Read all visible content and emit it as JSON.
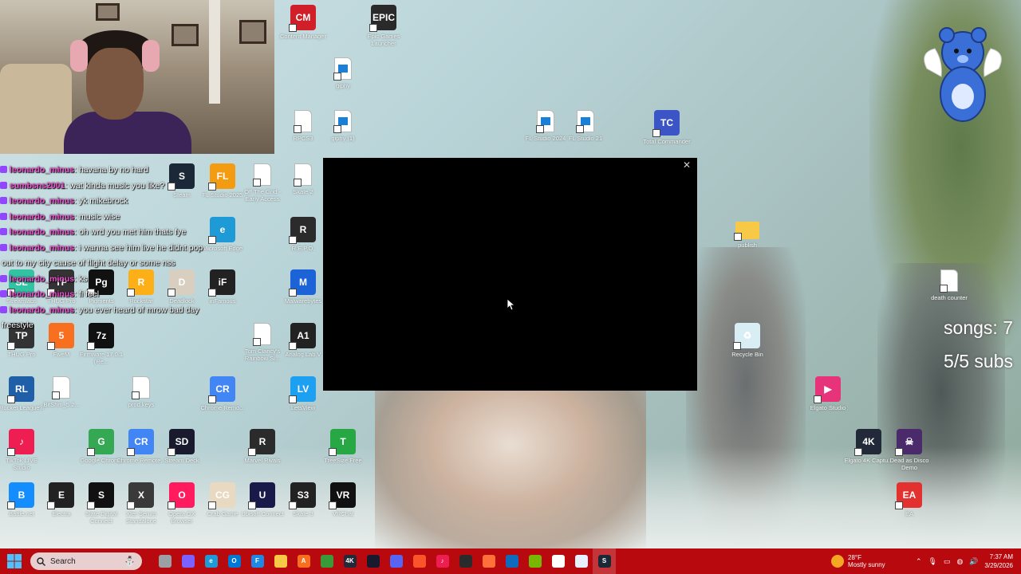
{
  "webcam": {
    "label": "webcam"
  },
  "chat": [
    {
      "user": "leonardo_minus",
      "text": ": havana by no hard"
    },
    {
      "user": "sumbsns2001",
      "text": ": wat kinda music you like?"
    },
    {
      "user": "leonardo_minus",
      "text": ": yk mikebrock"
    },
    {
      "user": "leonardo_minus",
      "text": ": music wise"
    },
    {
      "user": "leonardo_minus",
      "text": ": oh wrd you met him thats fye"
    },
    {
      "user": "leonardo_minus",
      "text": ": i wanna see him live he didnt pop"
    },
    {
      "user": "",
      "text": "out to my city cause of flight delay or some nss"
    },
    {
      "user": "leonardo_minus",
      "text": ": ks"
    },
    {
      "user": "leonardo_minus",
      "text": ": fi feel"
    },
    {
      "user": "leonardo_minus",
      "text": ": you ever heard of mrow bad day"
    },
    {
      "user": "",
      "text": "freestyle"
    }
  ],
  "desktop_icons": [
    {
      "label": "Content Manager",
      "icon": "content-manager-icon",
      "color": "#d11f2a",
      "glyph": "CM"
    },
    {
      "label": "Epic Games Launcher",
      "icon": "epic-games-icon",
      "color": "#2a2a2a",
      "glyph": "EPIC"
    },
    {
      "label": "giphy",
      "icon": "image-file-icon",
      "color": "#ffffff",
      "glyph": ""
    },
    {
      "label": "RPCS3",
      "icon": "file-icon",
      "color": "#ffffff",
      "glyph": ""
    },
    {
      "label": "giphy (1)",
      "icon": "image-file-icon",
      "color": "#ffffff",
      "glyph": ""
    },
    {
      "label": "FL Studio 2024",
      "icon": "image-file-icon",
      "color": "#ffffff",
      "glyph": ""
    },
    {
      "label": "FL Studio 21",
      "icon": "image-file-icon",
      "color": "#ffffff",
      "glyph": ""
    },
    {
      "label": "Total Commander",
      "icon": "floppy-icon",
      "color": "#3b55c6",
      "glyph": "TC"
    },
    {
      "label": "Steam",
      "icon": "steam-icon",
      "color": "#1b2838",
      "glyph": "S"
    },
    {
      "label": "FL Studio 2025",
      "icon": "fl-studio-icon",
      "color": "#f39c12",
      "glyph": "FL"
    },
    {
      "label": "Off The Grid - Early Access",
      "icon": "file-icon",
      "color": "#ffffff",
      "glyph": ""
    },
    {
      "label": "Skate 2",
      "icon": "file-icon",
      "color": "#ffffff",
      "glyph": ""
    },
    {
      "label": "Microsoft Edge",
      "icon": "edge-icon",
      "color": "#1e9bd7",
      "glyph": "e"
    },
    {
      "label": "R.E.P.O.",
      "icon": "repo-icon",
      "color": "#2b2b2b",
      "glyph": "R"
    },
    {
      "label": "publish",
      "icon": "folder-icon",
      "color": "#f8c947",
      "glyph": ""
    },
    {
      "label": "death counter",
      "icon": "file-icon",
      "color": "#ffffff",
      "glyph": ""
    },
    {
      "label": "Streamlabs",
      "icon": "streamlabs-icon",
      "color": "#31c3a2",
      "glyph": "SL"
    },
    {
      "label": "THUG Pro",
      "icon": "thug-pro-icon",
      "color": "#333333",
      "glyph": "TP"
    },
    {
      "label": "Pigments",
      "icon": "pigments-icon",
      "color": "#111111",
      "glyph": "Pg"
    },
    {
      "label": "Rockstar",
      "icon": "rockstar-icon",
      "color": "#fcaf17",
      "glyph": "R"
    },
    {
      "label": "Deadlock",
      "icon": "deadlock-icon",
      "color": "#d8cfc0",
      "glyph": "D"
    },
    {
      "label": "inFamous",
      "icon": "infamous-icon",
      "color": "#222222",
      "glyph": "iF"
    },
    {
      "label": "Malwarebytes",
      "icon": "malwarebytes-icon",
      "color": "#1c63d8",
      "glyph": "M"
    },
    {
      "label": "THUG Pro",
      "icon": "thug-pro-icon",
      "color": "#333333",
      "glyph": "TP"
    },
    {
      "label": "FiveM",
      "icon": "fivem-icon",
      "color": "#f76f1f",
      "glyph": "5"
    },
    {
      "label": "Firmware 17.0.1 (Re...",
      "icon": "7zip-icon",
      "color": "#111111",
      "glyph": "7z"
    },
    {
      "label": "Tom Clancy's Rainbow Si...",
      "icon": "file-icon",
      "color": "#ffffff",
      "glyph": ""
    },
    {
      "label": "Analog Lab V",
      "icon": "analog-lab-icon",
      "color": "#222222",
      "glyph": "A1"
    },
    {
      "label": "Recycle Bin",
      "icon": "recycle-bin-icon",
      "color": "#d9edf5",
      "glyph": "♻"
    },
    {
      "label": "Rocket League®",
      "icon": "rocket-league-icon",
      "color": "#1f5fa8",
      "glyph": "RL"
    },
    {
      "label": "BitShm_5.2...",
      "icon": "file-icon",
      "color": "#ffffff",
      "glyph": ""
    },
    {
      "label": "prod.keys",
      "icon": "file-icon",
      "color": "#ffffff",
      "glyph": ""
    },
    {
      "label": "Chrome Remo...",
      "icon": "chrome-remote-icon",
      "color": "#4285f4",
      "glyph": "CR"
    },
    {
      "label": "LetsView",
      "icon": "letsview-icon",
      "color": "#1da0f2",
      "glyph": "LV"
    },
    {
      "label": "Elgato Studio",
      "icon": "elgato-studio-icon",
      "color": "#e6337a",
      "glyph": "▶"
    },
    {
      "label": "TikTok LIVE Studio",
      "icon": "tiktok-icon",
      "color": "#ee1d52",
      "glyph": "♪"
    },
    {
      "label": "Google Chrome",
      "icon": "chrome-icon",
      "color": "#34a853",
      "glyph": "G"
    },
    {
      "label": "Chrome Remote...",
      "icon": "chrome-remote-icon",
      "color": "#4285f4",
      "glyph": "CR"
    },
    {
      "label": "Stream Deck",
      "icon": "stream-deck-icon",
      "color": "#1a1a2e",
      "glyph": "SD"
    },
    {
      "label": "Marvel Rivals",
      "icon": "marvel-rivals-icon",
      "color": "#2b2b2b",
      "glyph": "R"
    },
    {
      "label": "TreeSize Free",
      "icon": "treesize-icon",
      "color": "#28a745",
      "glyph": "T"
    },
    {
      "label": "Elgato 4K Captu...",
      "icon": "elgato-4k-icon",
      "color": "#222a3a",
      "glyph": "4K"
    },
    {
      "label": "Dead as Disco Demo",
      "icon": "dead-as-disco-icon",
      "color": "#4b2a6b",
      "glyph": "☠"
    },
    {
      "label": "Battle.net",
      "icon": "battlenet-icon",
      "color": "#148eff",
      "glyph": "B"
    },
    {
      "label": "Electra",
      "icon": "electra-icon",
      "color": "#222222",
      "glyph": "E"
    },
    {
      "label": "Slate Digital Connect",
      "icon": "slate-digital-icon",
      "color": "#111111",
      "glyph": "S"
    },
    {
      "label": "Xfer Serum Standalone",
      "icon": "serum-icon",
      "color": "#3a3a3a",
      "glyph": "X"
    },
    {
      "label": "Opera GX Browser",
      "icon": "opera-gx-icon",
      "color": "#ff1b5e",
      "glyph": "O"
    },
    {
      "label": "Crab Game",
      "icon": "crab-game-icon",
      "color": "#e8d9c0",
      "glyph": "CG"
    },
    {
      "label": "Ubisoft Connect",
      "icon": "ubisoft-icon",
      "color": "#1a1a4a",
      "glyph": "U"
    },
    {
      "label": "Skate 3",
      "icon": "skate3-icon",
      "color": "#222222",
      "glyph": "S3"
    },
    {
      "label": "VRChat",
      "icon": "vrchat-icon",
      "color": "#111111",
      "glyph": "VR"
    },
    {
      "label": "EA",
      "icon": "ea-icon",
      "color": "#e3312f",
      "glyph": "EA"
    }
  ],
  "black_window": {
    "close_glyph": "✕"
  },
  "overlay": {
    "songs": "songs: 7",
    "subs": "5/5 subs"
  },
  "taskbar": {
    "search_placeholder": "Search",
    "apps": [
      {
        "name": "task-view",
        "color": "#9aa0a6",
        "glyph": ""
      },
      {
        "name": "copilot",
        "color": "#7b61ff",
        "glyph": ""
      },
      {
        "name": "edge",
        "color": "#1e9bd7",
        "glyph": "e"
      },
      {
        "name": "outlook",
        "color": "#0078d4",
        "glyph": "O"
      },
      {
        "name": "fl-studio",
        "color": "#1e88e5",
        "glyph": "F"
      },
      {
        "name": "file-explorer",
        "color": "#f8c947",
        "glyph": ""
      },
      {
        "name": "fivem",
        "color": "#f76f1f",
        "glyph": "A"
      },
      {
        "name": "minecraft",
        "color": "#3a9a3a",
        "glyph": ""
      },
      {
        "name": "4k-capture",
        "color": "#222a3a",
        "glyph": "4K"
      },
      {
        "name": "stream-deck",
        "color": "#1a1a2e",
        "glyph": ""
      },
      {
        "name": "discord",
        "color": "#5865f2",
        "glyph": ""
      },
      {
        "name": "brave",
        "color": "#fb542b",
        "glyph": ""
      },
      {
        "name": "tiktok",
        "color": "#ee1d52",
        "glyph": "♪"
      },
      {
        "name": "obs",
        "color": "#2b2b2b",
        "glyph": ""
      },
      {
        "name": "firefox",
        "color": "#ff7139",
        "glyph": ""
      },
      {
        "name": "photos",
        "color": "#0f6cbd",
        "glyph": ""
      },
      {
        "name": "nvidia",
        "color": "#76b900",
        "glyph": ""
      },
      {
        "name": "notepad",
        "color": "#ffffff",
        "glyph": ""
      },
      {
        "name": "snipping",
        "color": "#e6f0ff",
        "glyph": ""
      },
      {
        "name": "steam",
        "color": "#1b2838",
        "glyph": "S"
      }
    ],
    "weather_temp": "28°F",
    "weather_desc": "Mostly sunny",
    "time": "7:37 AM",
    "date": "3/29/2026"
  }
}
